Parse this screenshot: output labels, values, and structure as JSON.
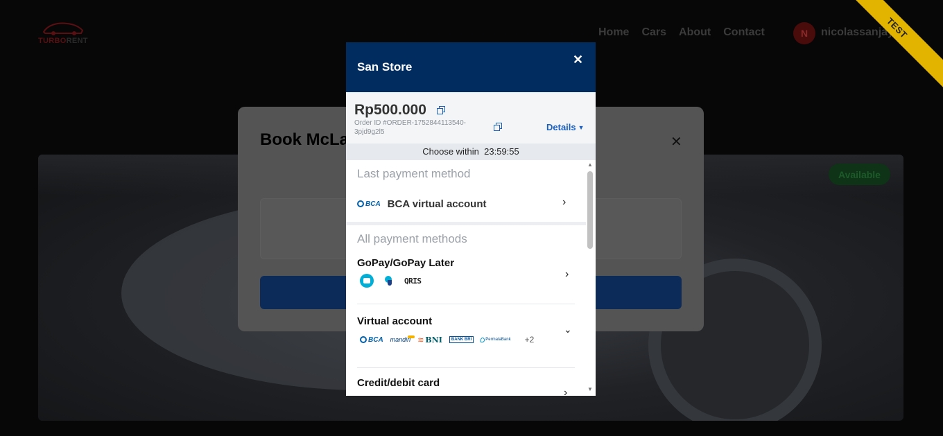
{
  "site": {
    "logo_text_1": "TURBO",
    "logo_text_2": "RENT",
    "nav": [
      "Home",
      "Cars",
      "About",
      "Contact"
    ],
    "avatar_initial": "N",
    "username": "nicolassanjaya",
    "ribbon": "TEST"
  },
  "booking": {
    "title": "Book McLaren",
    "close": "✕",
    "status_badge": "Available"
  },
  "payment": {
    "merchant": "San Store",
    "close": "✕",
    "amount": "Rp500.000",
    "order_id": "Order ID #ORDER-1752844113540-3pjd9g2l5",
    "details_label": "Details",
    "timer_label": "Choose within",
    "timer_value": "23:59:55",
    "last_section_title": "Last payment method",
    "last_method": "BCA virtual account",
    "all_section_title": "All payment methods",
    "methods": [
      {
        "title": "GoPay/GoPay Later",
        "icons": [
          "gopay-icon",
          "gopay-later-icon",
          "qris-icon"
        ],
        "qris_text": "QRIS"
      },
      {
        "title": "Virtual account",
        "icons": [
          "bca-icon",
          "mandiri-icon",
          "bni-icon",
          "bri-icon",
          "permata-icon"
        ],
        "more": "+2",
        "bank_labels": {
          "bca": "BCA",
          "mandiri": "mandiri",
          "bni": "BNI",
          "bri": "BANK BRI",
          "permata": "PermataBank"
        }
      },
      {
        "title": "Credit/debit card"
      }
    ]
  },
  "colors": {
    "header_bg": "#012c5f",
    "link_blue": "#1a5fc1",
    "ribbon": "#e2b400"
  }
}
